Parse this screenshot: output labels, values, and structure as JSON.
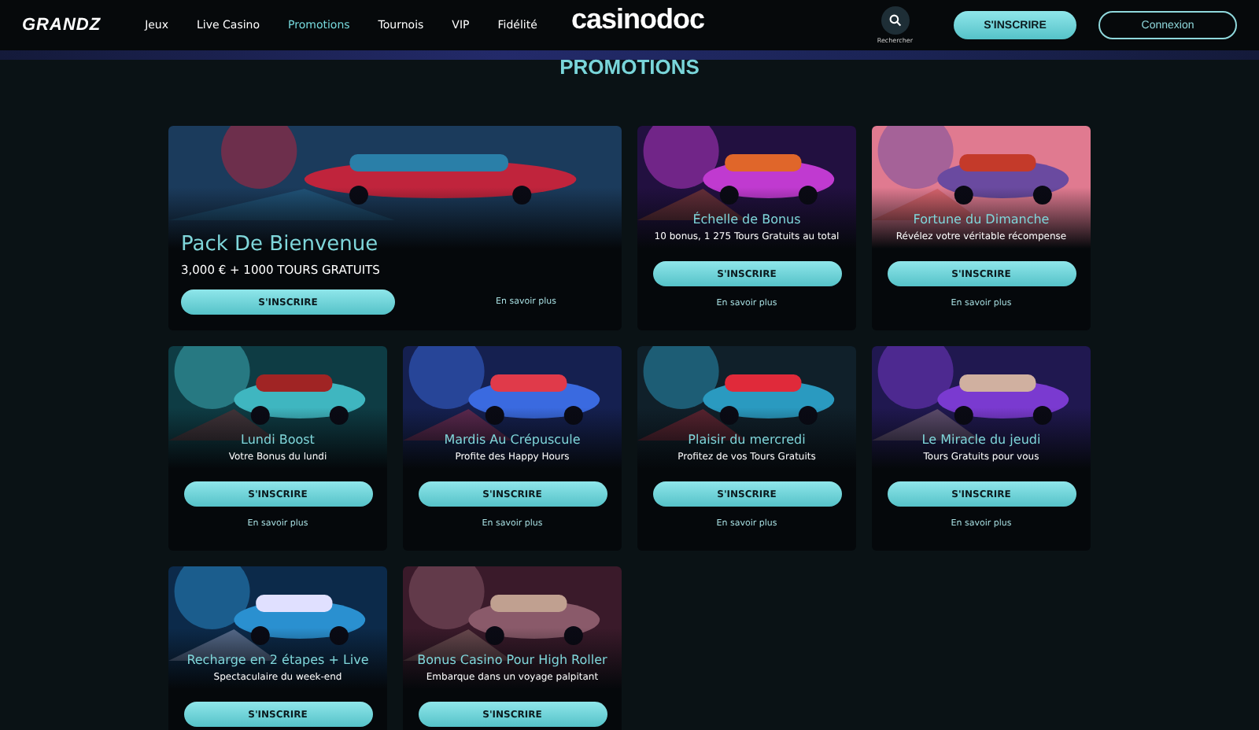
{
  "header": {
    "brand": "GRANDZ",
    "nav": [
      {
        "label": "Jeux",
        "selected": false
      },
      {
        "label": "Live Casino",
        "selected": false
      },
      {
        "label": "Promotions",
        "selected": true
      },
      {
        "label": "Tournois",
        "selected": false
      },
      {
        "label": "VIP",
        "selected": false
      },
      {
        "label": "Fidélité",
        "selected": false
      }
    ],
    "center_logo": "casinodoc",
    "search_label": "Rechercher",
    "signup": "S'INSCRIRE",
    "login": "Connexion"
  },
  "page_title": "PROMOTIONS",
  "cards": [
    {
      "kind": "featured",
      "title": "Pack De Bienvenue",
      "subtitle": "3,000 € + 1000 TOURS GRATUITS",
      "button": "S'INSCRIRE",
      "link": "En savoir plus"
    },
    {
      "kind": "standard",
      "title": "Échelle de Bonus",
      "subtitle": "10 bonus, 1 275 Tours Gratuits au total",
      "button": "S'INSCRIRE",
      "link": "En savoir plus"
    },
    {
      "kind": "standard",
      "title": "Fortune du Dimanche",
      "subtitle": "Révélez votre véritable récompense",
      "button": "S'INSCRIRE",
      "link": "En savoir plus"
    },
    {
      "kind": "standard",
      "title": "Lundi Boost",
      "subtitle": "Votre Bonus du lundi",
      "button": "S'INSCRIRE",
      "link": "En savoir plus"
    },
    {
      "kind": "standard",
      "title": "Mardis Au Crépuscule",
      "subtitle": "Profite des Happy Hours",
      "button": "S'INSCRIRE",
      "link": "En savoir plus"
    },
    {
      "kind": "standard",
      "title": "Plaisir du mercredi",
      "subtitle": "Profitez de vos Tours Gratuits",
      "button": "S'INSCRIRE",
      "link": "En savoir plus"
    },
    {
      "kind": "standard",
      "title": "Le Miracle du jeudi",
      "subtitle": "Tours Gratuits pour vous",
      "button": "S'INSCRIRE",
      "link": "En savoir plus"
    },
    {
      "kind": "standard",
      "title": "Recharge en 2 étapes + Live",
      "subtitle": "Spectaculaire du week-end",
      "button": "S'INSCRIRE"
    },
    {
      "kind": "standard",
      "title": "Bonus Casino Pour High Roller",
      "subtitle": "Embarque dans un voyage palpitant",
      "button": "S'INSCRIRE"
    }
  ]
}
